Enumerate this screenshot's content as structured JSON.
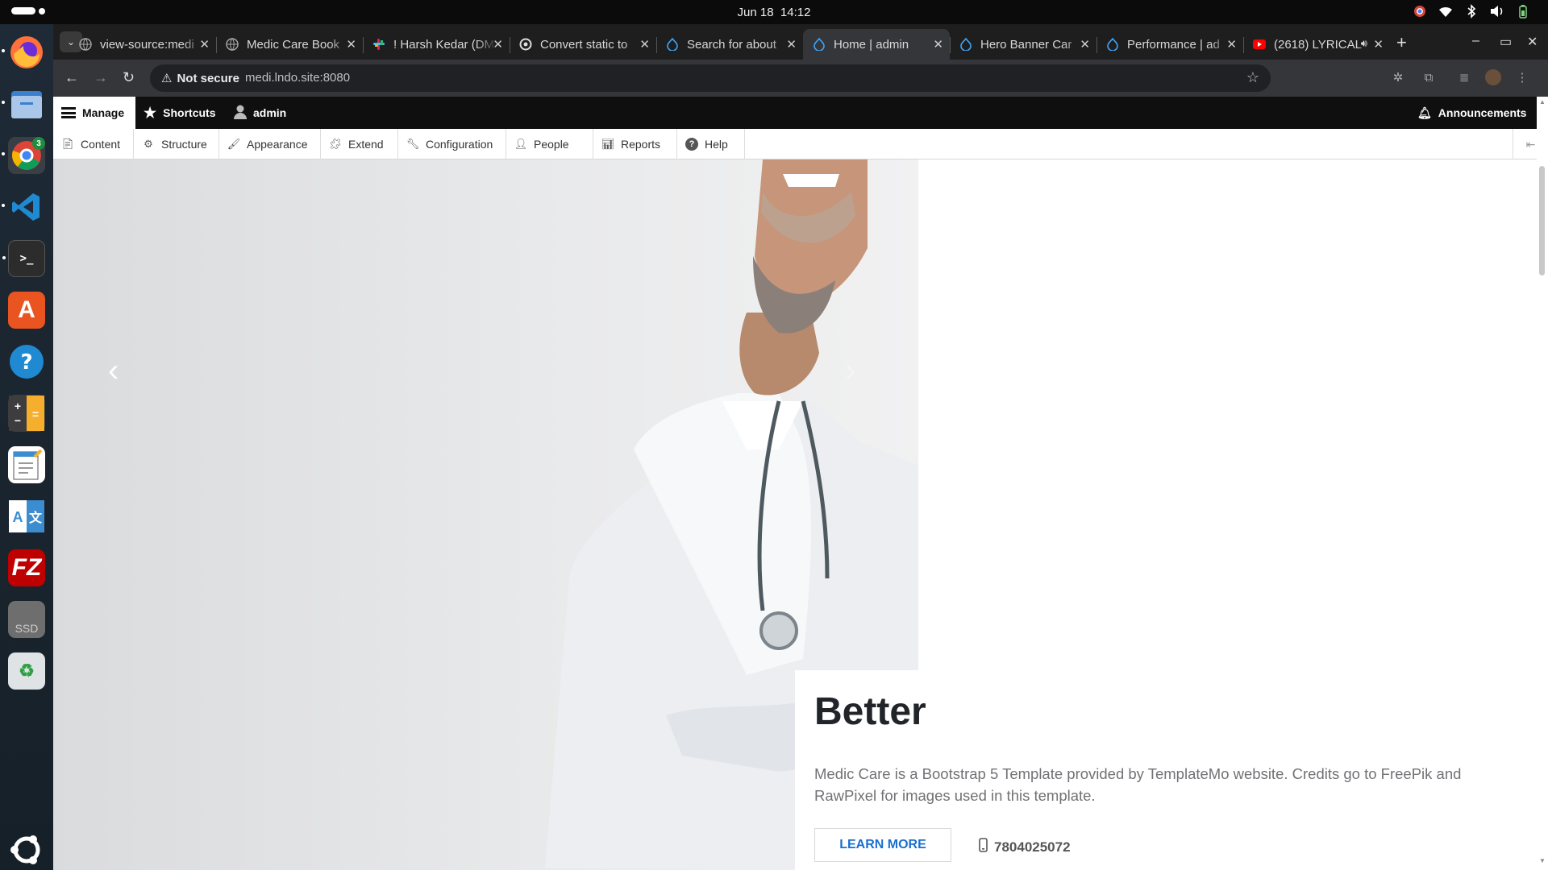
{
  "system": {
    "date": "Jun 18",
    "time": "14:12"
  },
  "dock": [
    "firefox-icon",
    "files-icon",
    "chrome-icon",
    "vscode-icon",
    "terminal-icon",
    "app-center-icon",
    "help-icon",
    "calculator-icon",
    "text-editor-icon",
    "translate-icon",
    "filezilla-icon",
    "ssd-icon",
    "trash-icon",
    "ubuntu-apps-icon"
  ],
  "dock_badge": "3",
  "dock_ssd_label": "SSD",
  "tabs": [
    {
      "title": "view-source:medi",
      "icon": "globe-icon",
      "active": false
    },
    {
      "title": "Medic Care Book",
      "icon": "globe-icon",
      "active": false
    },
    {
      "title": "! Harsh Kedar (DM",
      "icon": "slack-icon",
      "active": false
    },
    {
      "title": "Convert static to",
      "icon": "openai-icon",
      "active": false
    },
    {
      "title": "Search for about",
      "icon": "drupal-icon",
      "active": false
    },
    {
      "title": "Home | admin",
      "icon": "drupal-icon",
      "active": true
    },
    {
      "title": "Hero Banner Car",
      "icon": "drupal-icon",
      "active": false
    },
    {
      "title": "Performance | ad",
      "icon": "drupal-icon",
      "active": false
    },
    {
      "title": "(2618) LYRICAL",
      "icon": "youtube-icon",
      "active": false
    }
  ],
  "omnibox": {
    "security": "Not secure",
    "url": "medi.lndo.site:8080"
  },
  "drupal_toolbar": {
    "manage": "Manage",
    "shortcuts": "Shortcuts",
    "user": "admin",
    "announcements": "Announcements"
  },
  "admin_menu": [
    "Content",
    "Structure",
    "Appearance",
    "Extend",
    "Configuration",
    "People",
    "Reports",
    "Help"
  ],
  "hero": {
    "title": "Better",
    "text": "Medic Care is a Bootstrap 5 Template provided by TemplateMo website. Credits go to FreePik and RawPixel for images used in this template.",
    "button": "LEARN MORE",
    "phone": "7804025072"
  },
  "colors": {
    "drupal_bar": "#0f0f0f",
    "link_blue": "#1a6fd1",
    "coat": "#f4f5f7"
  }
}
